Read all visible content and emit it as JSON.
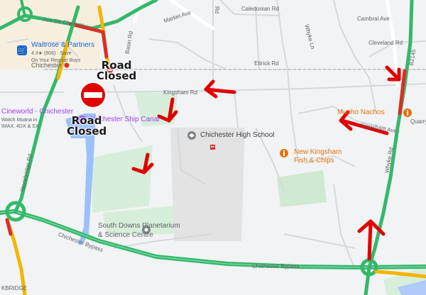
{
  "colors": {
    "background": "#f1f3f4",
    "park": "#d7eedb",
    "water": "#9cc0f9",
    "road": "#ffffff",
    "minor_road": "#d6d9dc",
    "traffic_green": "#34b86a",
    "traffic_yellow": "#f4b400",
    "traffic_red": "#d93025",
    "arrow_red": "#e00000",
    "poi_orange": "#e8710a",
    "poi_purple": "#a142f4",
    "poi_blue": "#1967d2"
  },
  "roads": {
    "ave_de_chartres": "Ave De Chartres",
    "market_ave": "Market Ave",
    "basin_rd": "Basin Rd",
    "caledonian_rd": "Caledonian Rd",
    "whyke_ln": "Whyke Ln",
    "cambral_ave": "Cambral Ave",
    "cleveland_rd": "Cleveland Rd",
    "ettrick_rd": "Ettrick Rd",
    "b2145": "B2145",
    "kingsham_rd": "Kingsham Rd",
    "kingsham_ave": "Kingsham Ave",
    "quarry": "Quarry",
    "stockbridge_rd": "Stockbridge Rd",
    "whyke_rd": "Whyke Rd",
    "chichester_bypass_1": "Chichester Bypass",
    "chichester_bypass_2": "Chichester Bypass",
    "stockbridge_edge": "KBRIDGE",
    "road_rd": "Rd"
  },
  "places": {
    "waitrose": {
      "name": "Waitrose & Partners",
      "rating": "4.3★ (606) · Save",
      "subtitle": "On Your Regular Buys",
      "icon": "shopping-cart-icon"
    },
    "chichester": "Chichester",
    "cineworld": {
      "name": "Cineworld - Chichester",
      "line1": "Watch Moana in",
      "line2": "IMAX, 4DX & SX"
    },
    "ship_canal": "Chichester Ship Canal",
    "high_school": "Chichester High School",
    "mucho_nachos": "Mucho Nachos",
    "fish_chips": {
      "line1": "New Kingsham",
      "line2": "Fish & Chips"
    },
    "planetarium": {
      "line1": "South Downs Planetarium",
      "line2": "& Science Centre"
    }
  },
  "annotations": {
    "road_closed_1": {
      "line1": "Road",
      "line2": "Closed"
    },
    "road_closed_2": {
      "line1": "Road",
      "line2": "Closed"
    },
    "no_entry_sign": "no-entry-icon",
    "arrow_count": 6
  }
}
